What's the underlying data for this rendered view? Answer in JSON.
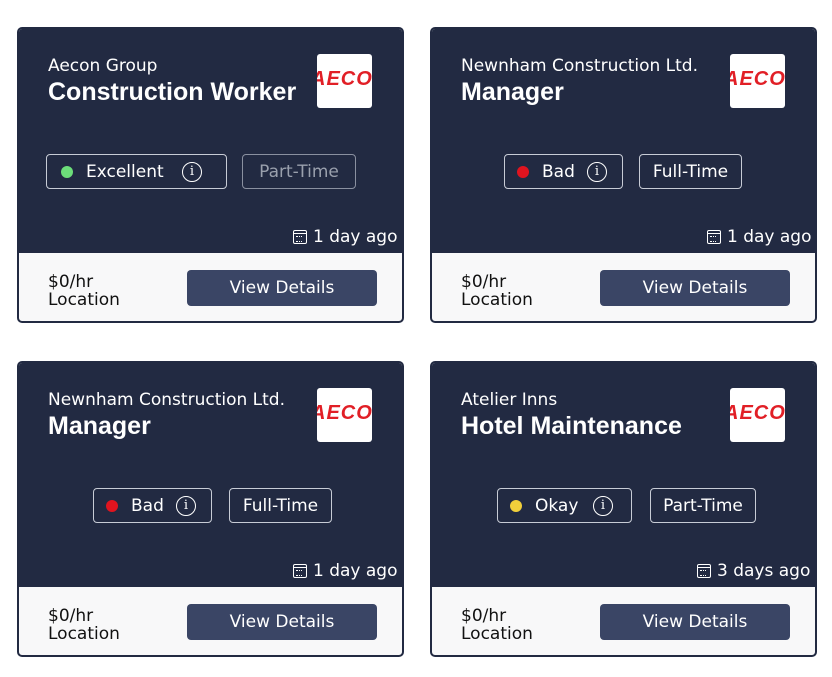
{
  "cards": [
    {
      "company": "Aecon Group",
      "title": "Construction Worker",
      "logo_text": "AECON",
      "rating": "Excellent",
      "rating_color": "#6cde7a",
      "job_type": "Part-Time",
      "posted": "1 day ago",
      "pay": "$0/hr",
      "location": "Location",
      "button": "View Details"
    },
    {
      "company": "Newnham Construction Ltd.",
      "title": "Manager",
      "logo_text": "AECON",
      "rating": "Bad",
      "rating_color": "#e0141f",
      "job_type": "Full-Time",
      "posted": "1 day ago",
      "pay": "$0/hr",
      "location": "Location",
      "button": "View Details"
    },
    {
      "company": "Newnham Construction Ltd.",
      "title": "Manager",
      "logo_text": "AECON",
      "rating": "Bad",
      "rating_color": "#e0141f",
      "job_type": "Full-Time",
      "posted": "1 day ago",
      "pay": "$0/hr",
      "location": "Location",
      "button": "View Details"
    },
    {
      "company": "Atelier Inns",
      "title": "Hotel Maintenance",
      "logo_text": "AECON",
      "rating": "Okay",
      "rating_color": "#f1cf3b",
      "job_type": "Part-Time",
      "posted": "3 days ago",
      "pay": "$0/hr",
      "location": "Location",
      "button": "View Details"
    }
  ]
}
